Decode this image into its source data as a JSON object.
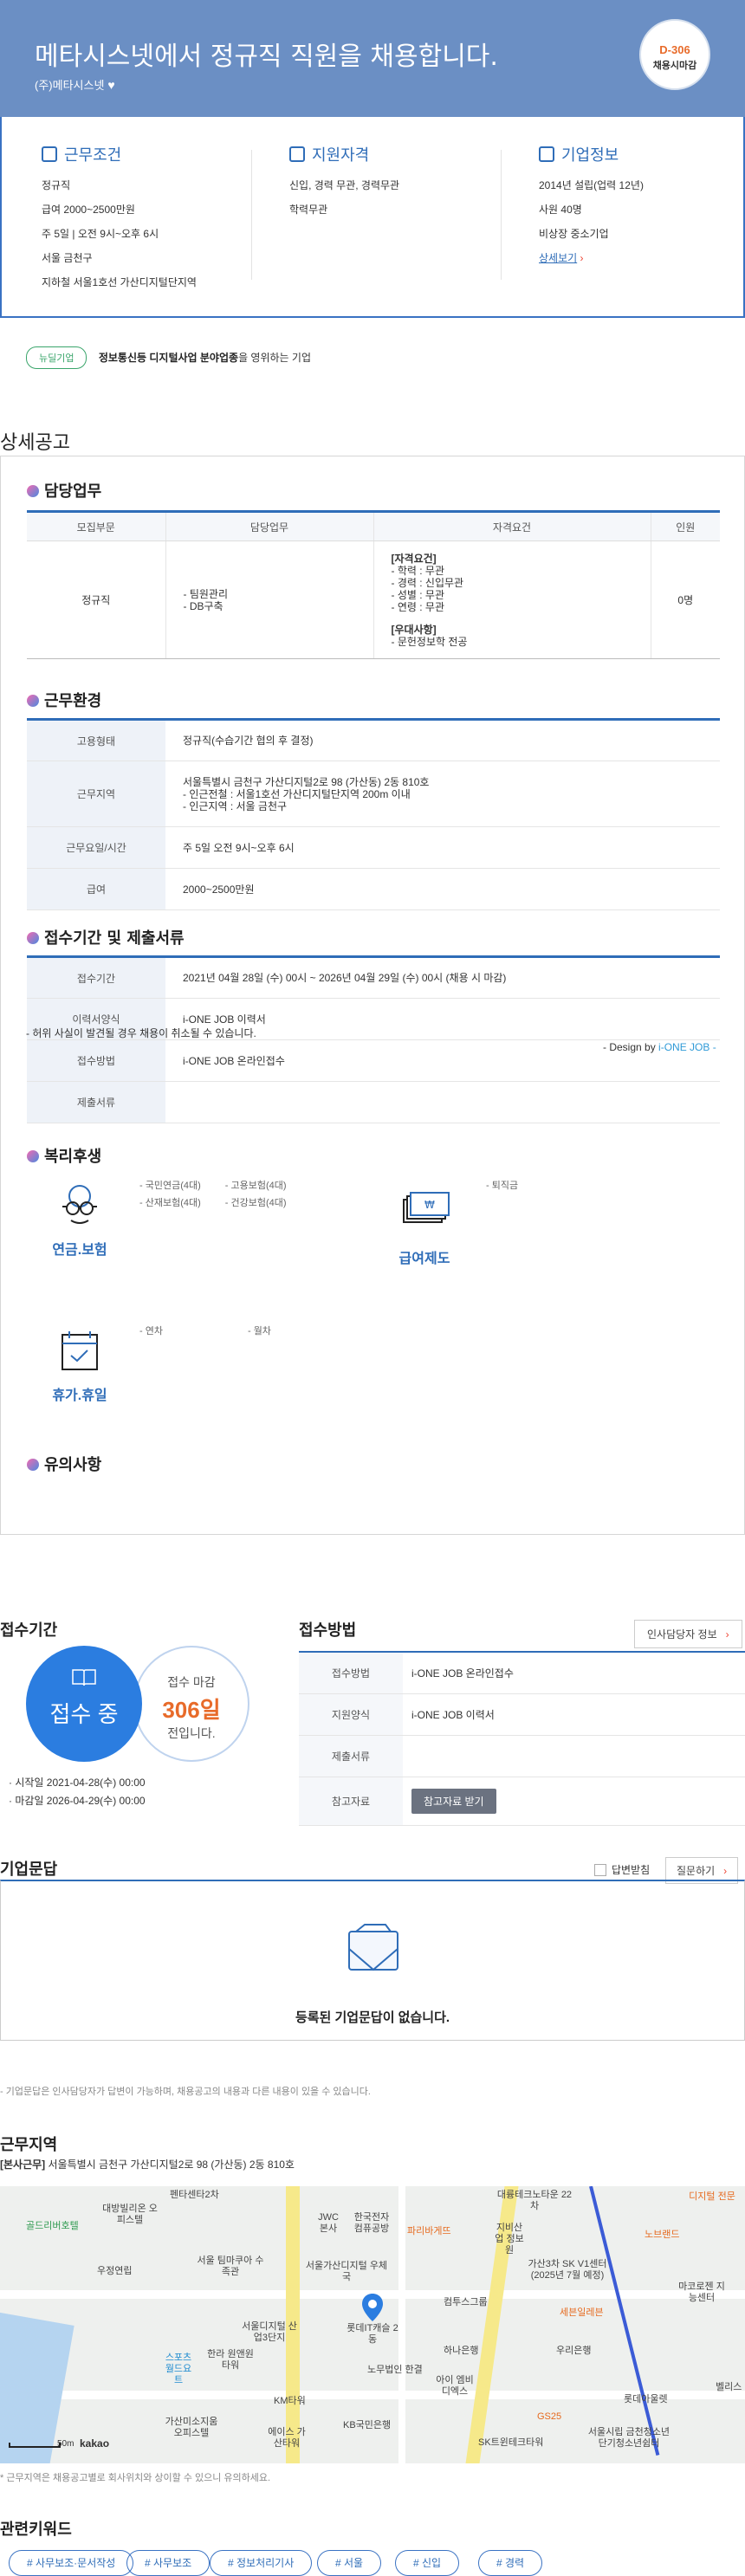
{
  "header": {
    "title": "메타시스넷에서 정규직 직원을 채용합니다.",
    "company": "(주)메타시스넷",
    "dday": "D-306",
    "dday_label": "채용시마감"
  },
  "info": {
    "work": {
      "title": "근무조건",
      "lines": [
        "정규직",
        "급여 2000~2500만원",
        "주 5일 | 오전 9시~오후 6시",
        "서울 금천구",
        "지하철 서울1호선 가산디지털단지역"
      ]
    },
    "qual": {
      "title": "지원자격",
      "lines": [
        "신입, 경력 무관, 경력무관",
        "학력무관"
      ]
    },
    "company": {
      "title": "기업정보",
      "lines": [
        "2014년 설립(업력 12년)",
        "사원 40명",
        "비상장 중소기업"
      ],
      "link": "상세보기"
    }
  },
  "badge": {
    "label": "뉴딜기업",
    "bold": "정보통신등 디지털사업 분야업종",
    "rest": "을 영위하는 기업"
  },
  "detail_title": "상세공고",
  "duty": {
    "title": "담당업무",
    "headers": [
      "모집부문",
      "담당업무",
      "자격요건",
      "인원"
    ],
    "row": {
      "dept": "정규직",
      "tasks": [
        "- 팀원관리",
        "- DB구축"
      ],
      "qual_head": "[자격요건]",
      "qual": [
        "- 학력 : 무관",
        "- 경력 : 신입무관",
        "- 성별 : 무관",
        "- 연령 : 무관"
      ],
      "pref_head": "[우대사항]",
      "pref": [
        "- 문헌정보학 전공"
      ],
      "count": "0명"
    }
  },
  "env": {
    "title": "근무환경",
    "rows": [
      {
        "k": "고용형태",
        "v": [
          "정규직(수습기간 협의 후 결정)"
        ]
      },
      {
        "k": "근무지역",
        "v": [
          "서울특별시 금천구 가산디지털2로 98 (가산동) 2동 810호",
          "- 인근전철 : 서울1호선 가산디지털단지역 200m 이내",
          "- 인근지역 : 서울 금천구"
        ]
      },
      {
        "k": "근무요일/시간",
        "v": [
          "주 5일 오전 9시~오후 6시"
        ]
      },
      {
        "k": "급여",
        "v": [
          "2000~2500만원"
        ]
      }
    ]
  },
  "apply": {
    "title": "접수기간 및 제출서류",
    "rows": [
      {
        "k": "접수기간",
        "v": "2021년 04월 28일 (수) 00시 ~ 2026년 04월 29일 (수) 00시 (채용 시 마감)"
      },
      {
        "k": "이력서양식",
        "v": "i-ONE JOB 이력서"
      },
      {
        "k": "접수방법",
        "v": "i-ONE JOB 온라인접수"
      },
      {
        "k": "제출서류",
        "v": ""
      }
    ]
  },
  "welfare": {
    "title": "복리후생",
    "pension": {
      "label": "연금.보험",
      "items": [
        "- 국민연금(4대)",
        "- 고용보험(4대)",
        "- 산재보험(4대)",
        "- 건강보험(4대)"
      ]
    },
    "pay": {
      "label": "급여제도",
      "items": [
        "- 퇴직금"
      ]
    },
    "vacation": {
      "label": "휴가.휴일",
      "items": [
        "- 연차",
        "- 월차"
      ]
    }
  },
  "caution": {
    "title": "유의사항",
    "text": "- 허위 사실이 발견될 경우 채용이 취소될 수 있습니다.",
    "design_pre": "- Design by ",
    "design_brand": "i-ONE JOB",
    "design_post": " -"
  },
  "period": {
    "title": "접수기간",
    "status": "접수 중",
    "deadline_top": "접수 마감",
    "deadline_days": "306일",
    "deadline_bot": "전입니다.",
    "start": "시작일 2021-04-28(수) 00:00",
    "end": "마감일 2026-04-29(수) 00:00"
  },
  "method": {
    "title": "접수방법",
    "contact_btn": "인사담당자 정보",
    "rows": [
      {
        "k": "접수방법",
        "v": "i-ONE JOB 온라인접수"
      },
      {
        "k": "지원양식",
        "v": "i-ONE JOB 이력서"
      },
      {
        "k": "제출서류",
        "v": ""
      },
      {
        "k": "참고자료",
        "v": ""
      }
    ],
    "ref_btn": "참고자료 받기"
  },
  "qna": {
    "title": "기업문답",
    "answered": "답변받침",
    "ask": "질문하기",
    "empty": "등록된 기업문답이 없습니다.",
    "note": "- 기업문답은 인사담당자가 답변이 가능하며, 채용공고의 내용과 다른 내용이 있을 수 있습니다."
  },
  "location": {
    "title": "근무지역",
    "tag": "[본사근무]",
    "address": "서울특별시 금천구 가산디지털2로 98 (가산동) 2동 810호",
    "scale": "50m",
    "brand": "kakao",
    "note": "* 근무지역은 채용공고별로 회사위치와 상이할 수 있으니 유의하세요."
  },
  "map_labels": [
    "골드리버호텔",
    "대방빌리온 오피스텔",
    "펜타센타2차",
    "JWC 본사",
    "한국전자 컴퓨공방",
    "파리바게뜨",
    "대륭테크노타운 22차",
    "지비산업 정보원",
    "디지털 전문",
    "노브랜드",
    "우정연립",
    "서울 팀마쿠아 수족관",
    "서울가산디지털 우체국",
    "롯데IT캐슬 2동",
    "컴투스그룹",
    "가산3차 SK V1센터 (2025년 7월 예정)",
    "세븐일레븐",
    "마코로젠 지능센터",
    "서울디지털 산업3단지",
    "스포츠 월드요트",
    "한라 원앤원타워",
    "노무법인 한결",
    "하나은행",
    "우리은행",
    "KM타워",
    "아이 엠비디엑스",
    "KB국민은행",
    "GS25",
    "가산미소지움 오피스텔",
    "에이스 가산타워",
    "SK트윈테크타워",
    "롯데아울렛",
    "서울시립 금천청소년 단기청소년쉼터",
    "벨리스"
  ],
  "keywords": {
    "title": "관련키워드",
    "items": [
      "# 사무보조·문서작성",
      "# 사무보조",
      "# 정보처리기사",
      "# 서울",
      "# 신입",
      "# 경력"
    ]
  }
}
